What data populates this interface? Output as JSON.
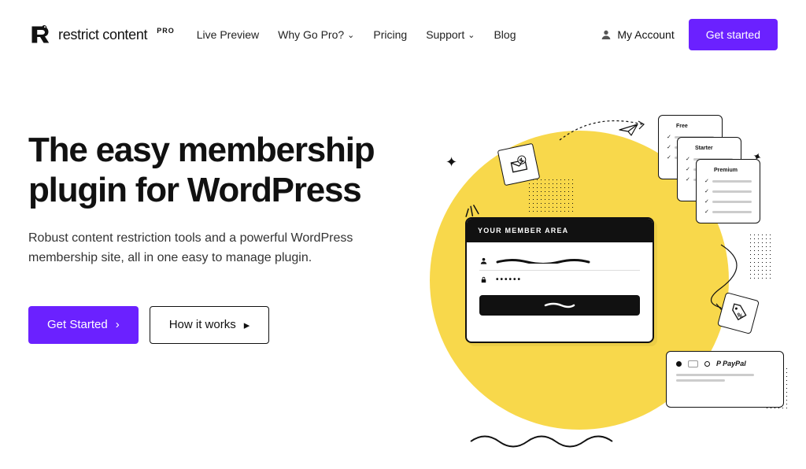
{
  "header": {
    "logo_text": "restrict content",
    "logo_badge": "PRO",
    "nav": {
      "live_preview": "Live Preview",
      "why_go_pro": "Why Go Pro?",
      "pricing": "Pricing",
      "support": "Support",
      "blog": "Blog"
    },
    "account": "My Account",
    "cta": "Get started"
  },
  "hero": {
    "title": "The easy membership plugin for WordPress",
    "subtitle": "Robust content restriction tools and a powerful WordPress membership site, all in one easy to manage plugin.",
    "primary_btn": "Get Started",
    "secondary_btn": "How it works"
  },
  "illustration": {
    "member_card_header": "YOUR MEMBER AREA",
    "password_dots": "••••••",
    "plans": {
      "free": "Free",
      "starter": "Starter",
      "premium": "Premium"
    },
    "payments": {
      "paypal": "PayPal"
    }
  }
}
